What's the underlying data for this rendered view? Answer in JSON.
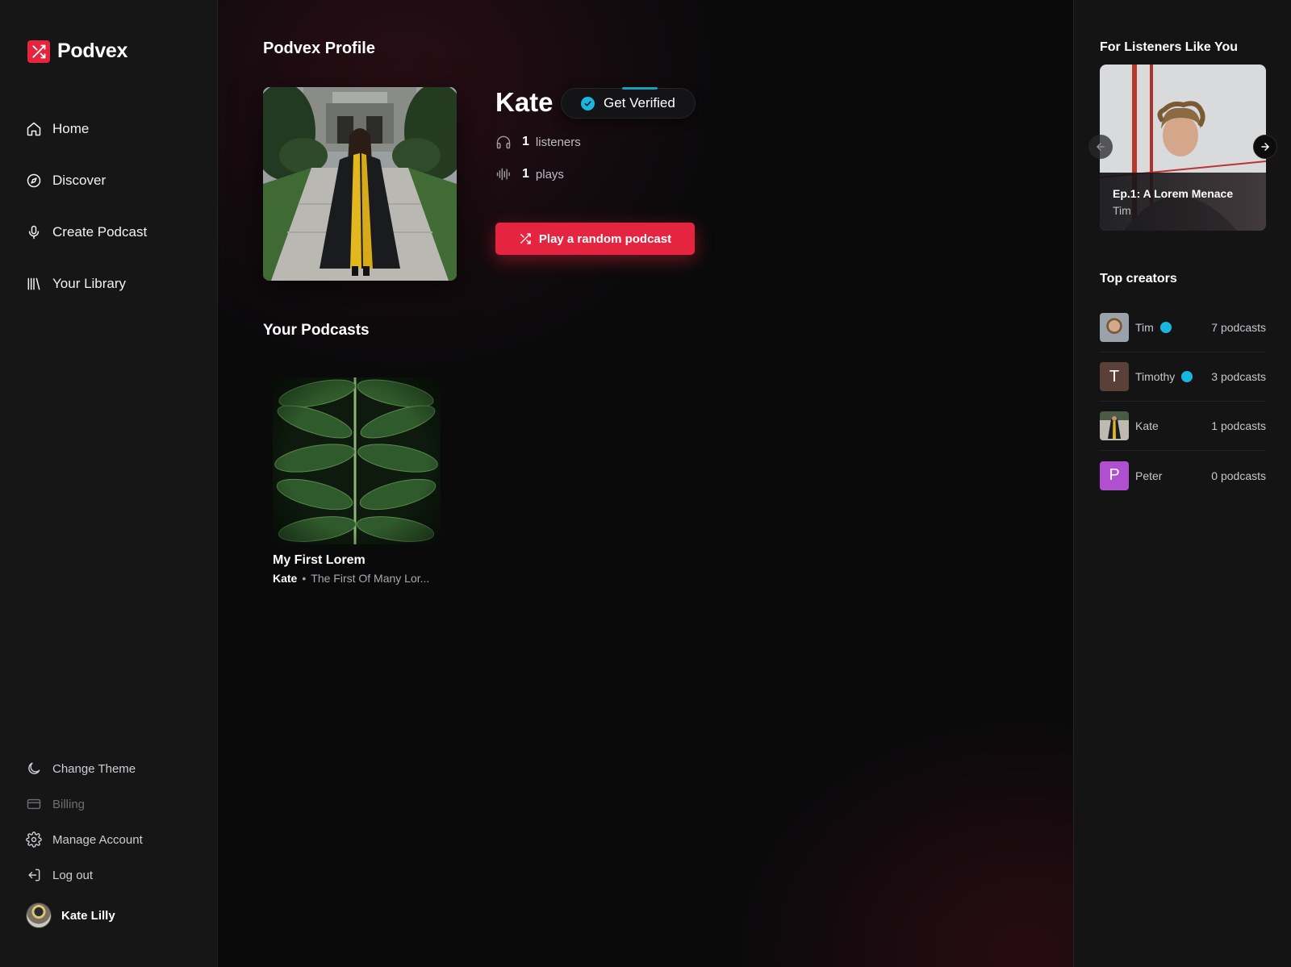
{
  "app": {
    "name": "Podvex",
    "accent_color": "#e5243f",
    "verified_color": "#19b7df"
  },
  "sidebar": {
    "nav": [
      {
        "label": "Home",
        "icon": "home-icon"
      },
      {
        "label": "Discover",
        "icon": "compass-icon"
      },
      {
        "label": "Create Podcast",
        "icon": "microphone-icon"
      },
      {
        "label": "Your Library",
        "icon": "library-icon"
      }
    ],
    "bottom": [
      {
        "label": "Change Theme",
        "icon": "moon-icon"
      },
      {
        "label": "Billing",
        "icon": "credit-card-icon",
        "disabled": true
      },
      {
        "label": "Manage Account",
        "icon": "gear-icon"
      },
      {
        "label": "Log out",
        "icon": "logout-icon"
      }
    ],
    "user": {
      "name": "Kate Lilly"
    }
  },
  "main": {
    "title": "Podvex Profile",
    "profile": {
      "name": "Kate",
      "verify_label": "Get Verified",
      "listeners_count": "1",
      "listeners_label": "listeners",
      "plays_count": "1",
      "plays_label": "plays",
      "random_button_label": "Play a random podcast"
    },
    "podcasts_title": "Your Podcasts",
    "podcasts": [
      {
        "title": "My First Lorem",
        "author": "Kate",
        "description": "The First Of Many Lor..."
      }
    ]
  },
  "rightbar": {
    "listeners_title": "For Listeners Like You",
    "featured": {
      "title": "Ep.1: A Lorem Menace",
      "author": "Tim"
    },
    "creators_title": "Top creators",
    "creators": [
      {
        "name": "Tim",
        "verified": true,
        "count": "7 podcasts",
        "avatar": "photo",
        "color": "#7d8a94"
      },
      {
        "name": "Timothy",
        "verified": true,
        "count": "3 podcasts",
        "initial": "T",
        "color": "#5b4038"
      },
      {
        "name": "Kate",
        "verified": false,
        "count": "1 podcasts",
        "avatar": "photo",
        "color": "#8a8474"
      },
      {
        "name": "Peter",
        "verified": false,
        "count": "0 podcasts",
        "initial": "P",
        "color": "#b04fd0"
      }
    ]
  }
}
